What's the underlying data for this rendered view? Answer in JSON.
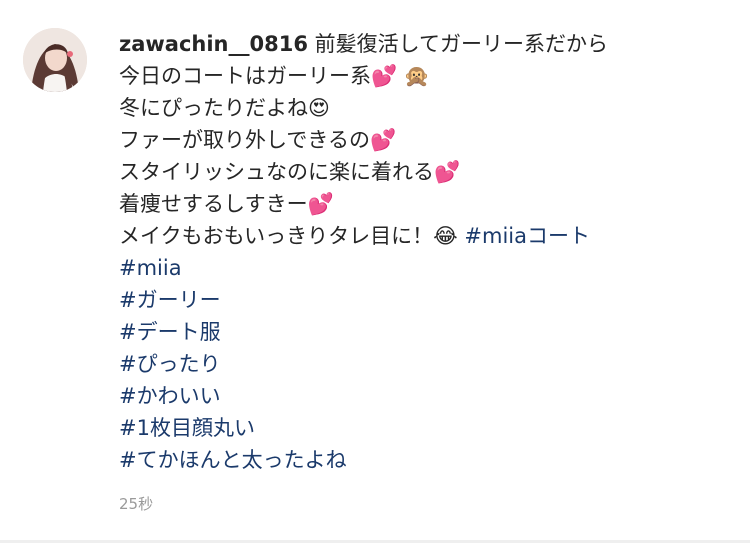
{
  "comment": {
    "username": "zawachin__0816",
    "lines": [
      "前髪復活してガーリー系だから",
      "今日のコートはガーリー系💕 🙊",
      "冬にぴったりだよね😍",
      "ファーが取り外しできるの💕",
      "スタイリッシュなのに楽に着れる💕",
      "着痩せするしすきー💕",
      "メイクもおもいっきりタレ目に！😂"
    ],
    "inline_hashtag": "#miiaコート",
    "hashtags": [
      "#miia",
      "#ガーリー",
      "#デート服",
      "#ぴったり",
      "#かわいい",
      "#1枚目顔丸い",
      "#てかほんと太ったよね"
    ],
    "timestamp": "25秒",
    "avatar_icon": "profile-photo",
    "colors": {
      "text": "#262626",
      "hashtag": "#1b3a6b",
      "timestamp": "#9a9a9a"
    }
  }
}
